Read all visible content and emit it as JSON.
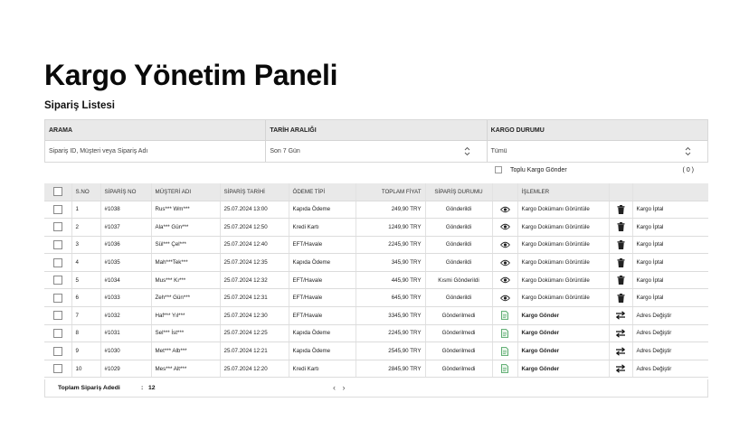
{
  "page": {
    "title": "Kargo Yönetim Paneli",
    "subtitle": "Sipariş Listesi"
  },
  "filters": {
    "search_label": "ARAMA",
    "search_placeholder": "Sipariş ID, Müşteri veya Sipariş Adı",
    "date_label": "TARİH ARALIĞI",
    "date_value": "Son 7 Gün",
    "status_label": "KARGO DURUMU",
    "status_value": "Tümü"
  },
  "bulk": {
    "label": "Toplu Kargo Gönder",
    "count": "( 0 )"
  },
  "table": {
    "headers": {
      "no": "S.NO",
      "order_no": "SİPARİŞ NO",
      "customer": "MÜŞTERİ ADI",
      "date": "SİPARİŞ TARİHİ",
      "payment": "ÖDEME TİPİ",
      "total": "TOPLAM FİYAT",
      "status": "SİPARİŞ DURUMU",
      "actions": "İŞLEMLER"
    },
    "rows": [
      {
        "no": "1",
        "order": "#1038",
        "customer": "Rus*** Wm***",
        "date": "25.07.2024 13:00",
        "payment": "Kapıda Ödeme",
        "total": "249,90 TRY",
        "status": "Gönderildi",
        "action": "Kargo Dokümanı Görüntüle",
        "action2": "Kargo İptal"
      },
      {
        "no": "2",
        "order": "#1037",
        "customer": "Ala*** Gün***",
        "date": "25.07.2024 12:50",
        "payment": "Kredi Kartı",
        "total": "1249,90 TRY",
        "status": "Gönderildi",
        "action": "Kargo Dokümanı Görüntüle",
        "action2": "Kargo İptal"
      },
      {
        "no": "3",
        "order": "#1036",
        "customer": "Sül*** Çel***",
        "date": "25.07.2024 12:40",
        "payment": "EFT/Havale",
        "total": "2245,90 TRY",
        "status": "Gönderildi",
        "action": "Kargo Dokümanı Görüntüle",
        "action2": "Kargo İptal"
      },
      {
        "no": "4",
        "order": "#1035",
        "customer": "Mah***Tek***",
        "date": "25.07.2024 12:35",
        "payment": "Kapıda Ödeme",
        "total": "345,90 TRY",
        "status": "Gönderildi",
        "action": "Kargo Dokümanı Görüntüle",
        "action2": "Kargo İptal"
      },
      {
        "no": "5",
        "order": "#1034",
        "customer": "Mus*** Kı***",
        "date": "25.07.2024 12:32",
        "payment": "EFT/Havale",
        "total": "445,90 TRY",
        "status": "Kısmi Gönderildi",
        "action": "Kargo Dokümanı Görüntüle",
        "action2": "Kargo İptal"
      },
      {
        "no": "6",
        "order": "#1033",
        "customer": "Zeh*** Gün***",
        "date": "25.07.2024 12:31",
        "payment": "EFT/Havale",
        "total": "645,90 TRY",
        "status": "Gönderildi",
        "action": "Kargo Dokümanı Görüntüle",
        "action2": "Kargo İptal"
      },
      {
        "no": "7",
        "order": "#1032",
        "customer": "Haf*** Yıl***",
        "date": "25.07.2024 12:30",
        "payment": "EFT/Havale",
        "total": "3345,90 TRY",
        "status": "Gönderilmedi",
        "action": "Kargo Gönder",
        "action2": "Adres Değiştir"
      },
      {
        "no": "8",
        "order": "#1031",
        "customer": "Sel*** İst***",
        "date": "25.07.2024 12:25",
        "payment": "Kapıda Ödeme",
        "total": "2245,90 TRY",
        "status": "Gönderilmedi",
        "action": "Kargo Gönder",
        "action2": "Adres Değiştir"
      },
      {
        "no": "9",
        "order": "#1030",
        "customer": "Met*** Alb***",
        "date": "25.07.2024 12:21",
        "payment": "Kapıda Ödeme",
        "total": "2545,90 TRY",
        "status": "Gönderilmedi",
        "action": "Kargo Gönder",
        "action2": "Adres Değiştir"
      },
      {
        "no": "10",
        "order": "#1029",
        "customer": "Mes*** Alt***",
        "date": "25.07.2024 12:20",
        "payment": "Kredi Kartı",
        "total": "2845,90 TRY",
        "status": "Gönderilmedi",
        "action": "Kargo Gönder",
        "action2": "Adres Değiştir"
      }
    ]
  },
  "footer": {
    "total_label": "Toplam Sipariş Adedi",
    "separator": ":",
    "total_value": "12",
    "prev": "‹",
    "next": "›"
  },
  "colors": {
    "sent": "#2a8a44",
    "cancel": "#c0392b",
    "header_bg": "#e9e9e9"
  }
}
